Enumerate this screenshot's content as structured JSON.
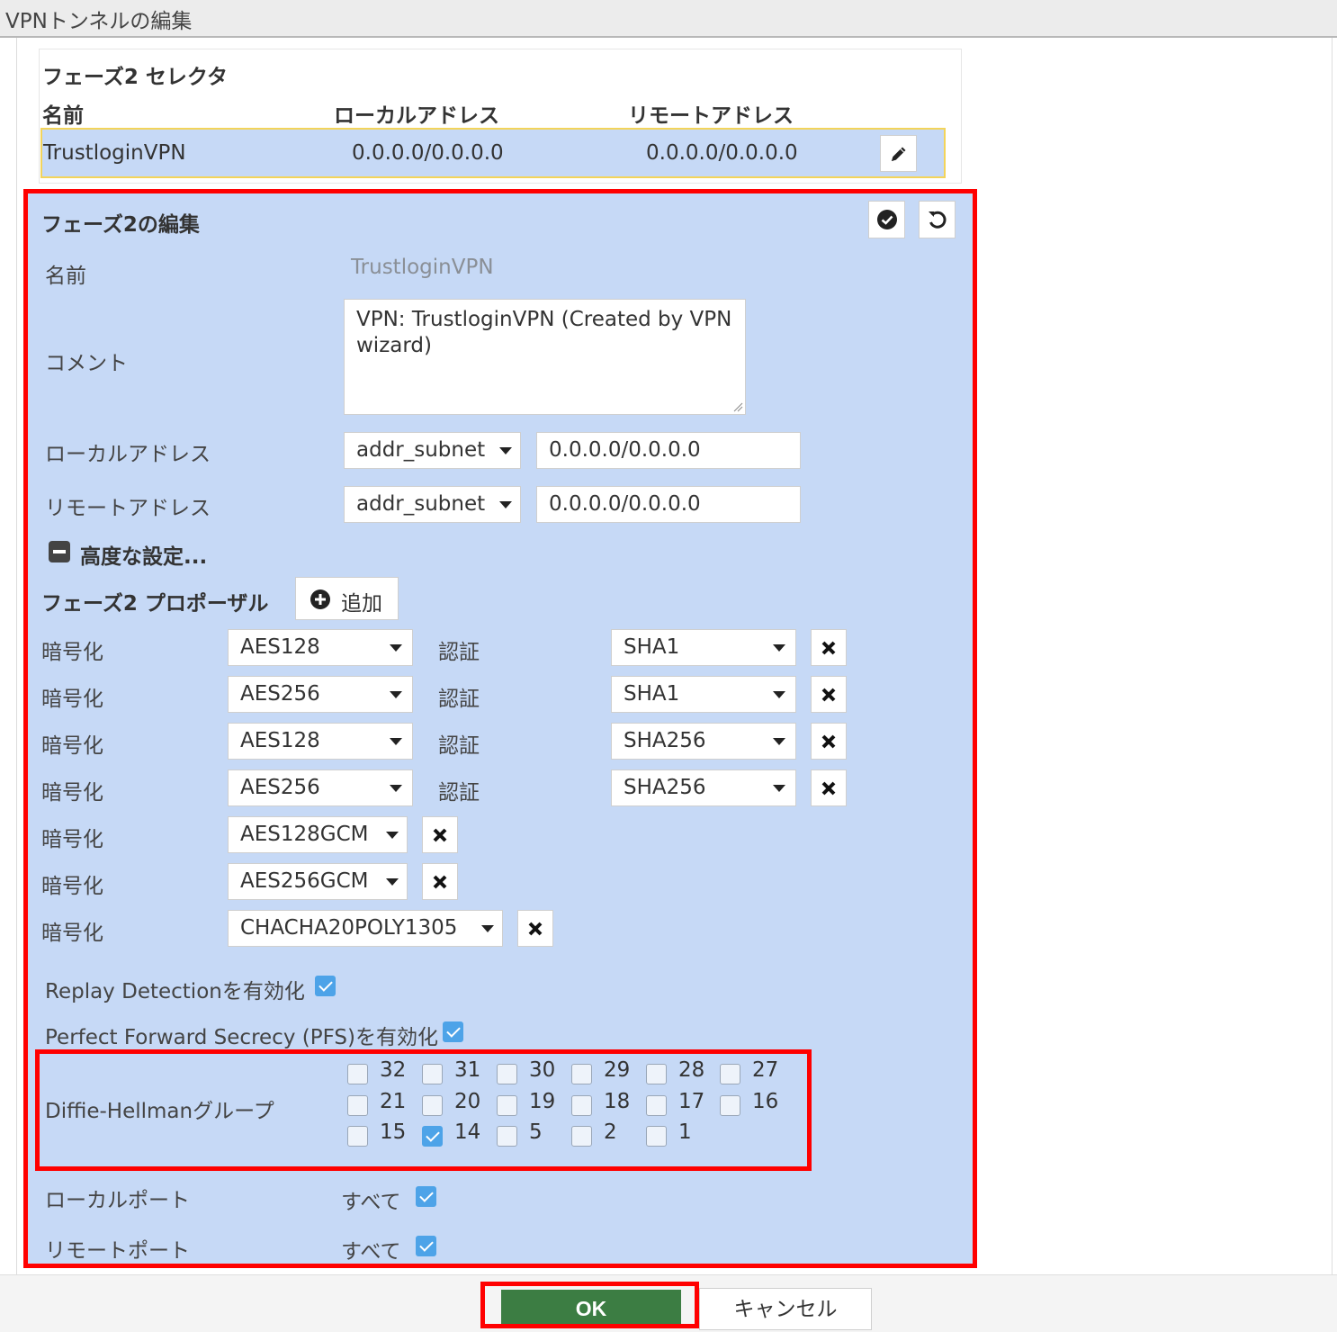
{
  "window": {
    "title": "VPNトンネルの編集"
  },
  "selector": {
    "title": "フェーズ2 セレクタ",
    "headers": {
      "name": "名前",
      "local": "ローカルアドレス",
      "remote": "リモートアドレス"
    },
    "row": {
      "name": "TrustloginVPN",
      "local": "0.0.0.0/0.0.0.0",
      "remote": "0.0.0.0/0.0.0.0"
    }
  },
  "edit": {
    "title": "フェーズ2の編集",
    "name_label": "名前",
    "name_value": "TrustloginVPN",
    "comment_label": "コメント",
    "comment_value": "VPN: TrustloginVPN (Created by VPN wizard)",
    "local_label": "ローカルアドレス",
    "local_type": "addr_subnet",
    "local_value": "0.0.0.0/0.0.0.0",
    "remote_label": "リモートアドレス",
    "remote_type": "addr_subnet",
    "remote_value": "0.0.0.0/0.0.0.0",
    "advanced_label": "高度な設定...",
    "proposal_label": "フェーズ2 プロポーザル",
    "add_label": "追加",
    "enc_label": "暗号化",
    "auth_label": "認証",
    "proposals": [
      {
        "enc": "AES128",
        "auth": "SHA1"
      },
      {
        "enc": "AES256",
        "auth": "SHA1"
      },
      {
        "enc": "AES128",
        "auth": "SHA256"
      },
      {
        "enc": "AES256",
        "auth": "SHA256"
      },
      {
        "enc": "AES128GCM"
      },
      {
        "enc": "AES256GCM"
      },
      {
        "enc": "CHACHA20POLY1305"
      }
    ],
    "replay_label": "Replay Detectionを有効化",
    "replay_checked": true,
    "pfs_label": "Perfect Forward Secrecy (PFS)を有効化",
    "pfs_checked": true,
    "dh_label": "Diffie-Hellmanグループ",
    "dh_groups": [
      {
        "num": "32",
        "checked": false
      },
      {
        "num": "31",
        "checked": false
      },
      {
        "num": "30",
        "checked": false
      },
      {
        "num": "29",
        "checked": false
      },
      {
        "num": "28",
        "checked": false
      },
      {
        "num": "27",
        "checked": false
      },
      {
        "num": "21",
        "checked": false
      },
      {
        "num": "20",
        "checked": false
      },
      {
        "num": "19",
        "checked": false
      },
      {
        "num": "18",
        "checked": false
      },
      {
        "num": "17",
        "checked": false
      },
      {
        "num": "16",
        "checked": false
      },
      {
        "num": "15",
        "checked": false
      },
      {
        "num": "14",
        "checked": true
      },
      {
        "num": "5",
        "checked": false
      },
      {
        "num": "2",
        "checked": false
      },
      {
        "num": "1",
        "checked": false
      }
    ],
    "local_port_label": "ローカルポート",
    "local_port_value": "すべて",
    "local_port_checked": true,
    "remote_port_label": "リモートポート",
    "remote_port_value": "すべて",
    "remote_port_checked": true
  },
  "footer": {
    "ok_label": "OK",
    "cancel_label": "キャンセル"
  },
  "colors": {
    "panel": "#c6d9f6",
    "highlight": "#ff0000",
    "ok": "#3c7d43",
    "check": "#4da3e8"
  }
}
